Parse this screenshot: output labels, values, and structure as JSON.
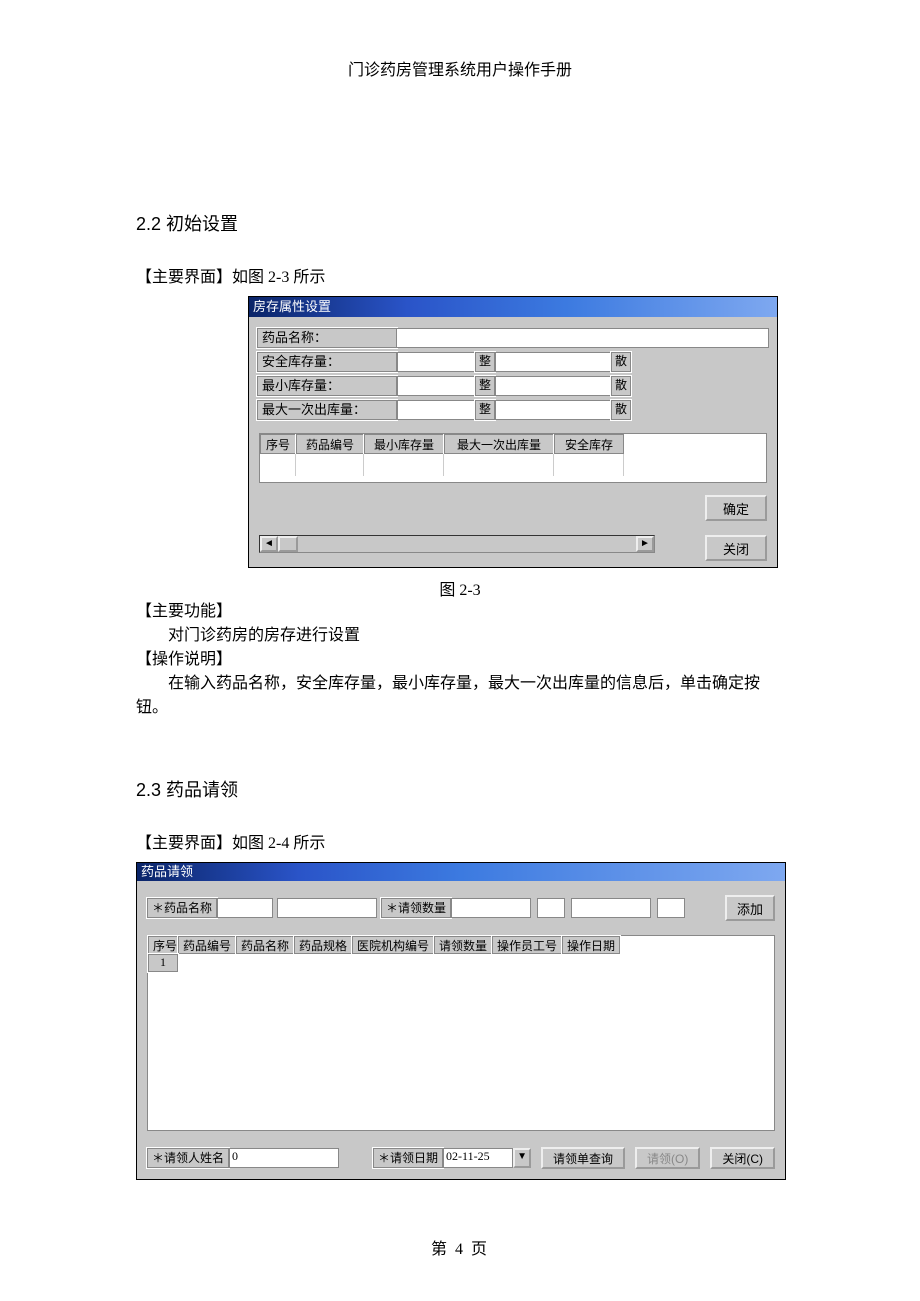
{
  "header": "门诊药房管理系统用户操作手册",
  "sec22": {
    "heading": "2.2 初始设置",
    "mainUi": "【主要界面】如图 2-3 所示",
    "mainFunc": "【主要功能】",
    "funcBody": "对门诊药房的房存进行设置",
    "op": "【操作说明】",
    "opBody": "在输入药品名称，安全库存量，最小库存量，最大一次出库量的信息后，单击确定按钮。"
  },
  "fig23": {
    "caption": "图 2-3",
    "title": "房存属性设置",
    "labels": {
      "name": "药品名称：",
      "safe": "安全库存量：",
      "min": "最小库存量：",
      "maxOut": "最大一次出库量：",
      "unitWhole": "整",
      "unitLoose": "散"
    },
    "columns": [
      "序号",
      "药品编号",
      "最小库存量",
      "最大一次出库量",
      "安全库存"
    ],
    "buttons": {
      "ok": "确定",
      "close": "关闭"
    }
  },
  "sec23": {
    "heading": "2.3 药品请领",
    "mainUi": "【主要界面】如图 2-4 所示"
  },
  "fig24": {
    "title": "药品请领",
    "fields": {
      "name": "＊药品名称",
      "qty": "＊请领数量",
      "person": "＊请领人姓名",
      "date": "＊请领日期"
    },
    "values": {
      "person": "0",
      "date": "02-11-25"
    },
    "columns": [
      "序号",
      "药品编号",
      "药品名称",
      "药品规格",
      "医院机构编号",
      "请领数量",
      "操作员工号",
      "操作日期"
    ],
    "row1": "1",
    "buttons": {
      "add": "添加",
      "query": "请领单查询",
      "submit": "请领(O)",
      "close": "关闭(C)"
    }
  },
  "pageNumber": "第 4 页"
}
